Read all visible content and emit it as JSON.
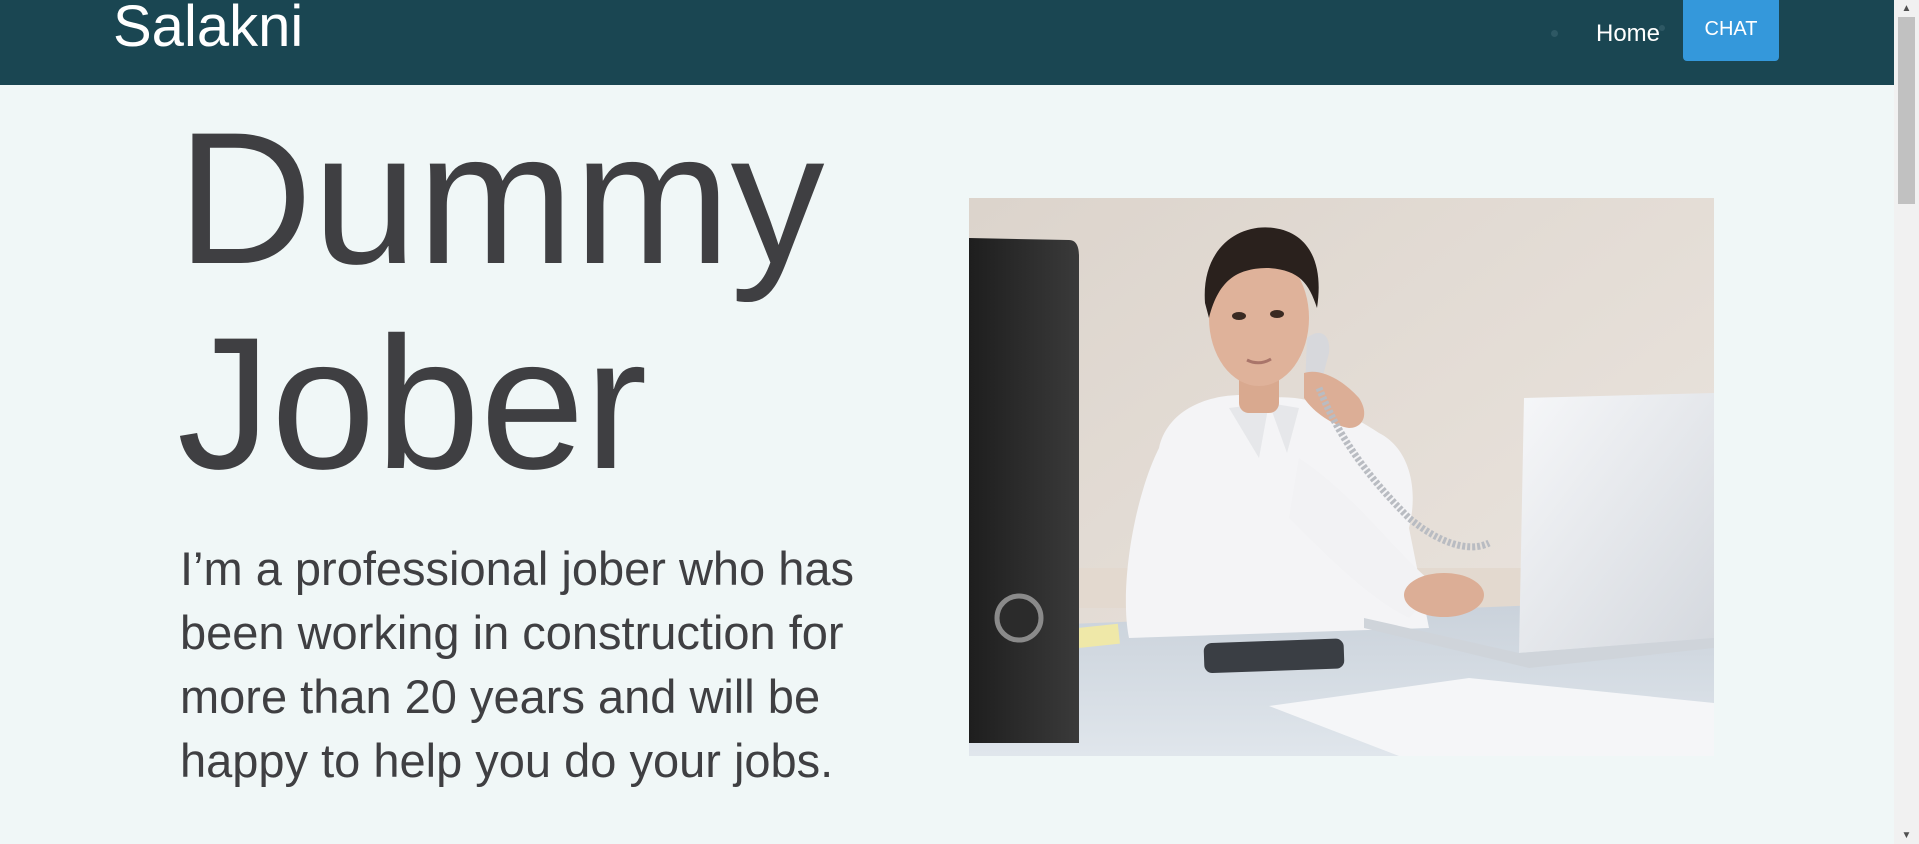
{
  "navbar": {
    "brand": "Salakni",
    "home_label": "Home",
    "chat_label": "CHAT",
    "background_color": "#1a4652",
    "chat_color": "#3498db"
  },
  "hero": {
    "title_lines": [
      "Dummy",
      "Jober"
    ],
    "description_lines": [
      "I’m a professional jober who has",
      "been working in construction for",
      "more than 20 years and will be",
      "happy to help you do your jobs."
    ],
    "text_color": "#3f3f42",
    "page_background": "#f0f7f7"
  },
  "photo": {
    "subject": "man in white shirt on phone at desk with laptop"
  },
  "scrollbar": {
    "up_icon": "arrow-up-icon",
    "down_icon": "arrow-down-icon"
  }
}
